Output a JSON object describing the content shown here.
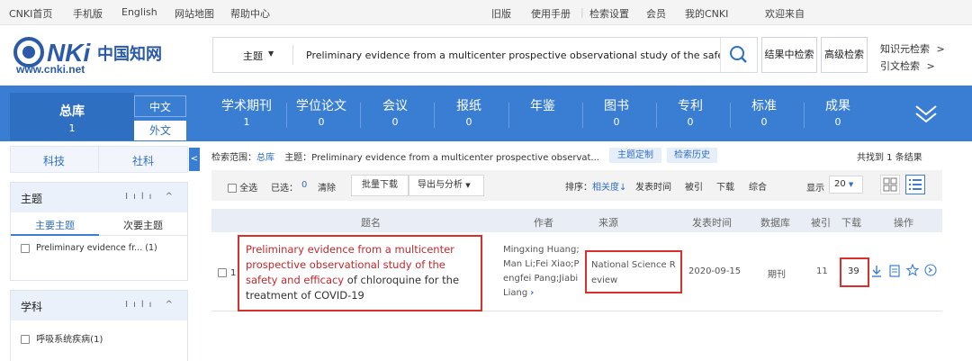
{
  "topbar": {
    "left_links": [
      "CNKI首页",
      "手机版",
      "English",
      "网站地图",
      "帮助中心"
    ],
    "right_links": [
      "旧版",
      "使用手册",
      "检索设置",
      "会员",
      "我的CNKI"
    ],
    "welcome": "欢迎来自"
  },
  "logo": {
    "brand": "CNKi中国知网",
    "url_text": "www.cnki.net"
  },
  "search": {
    "field": "主题",
    "query": "Preliminary evidence from a multicenter prospective observational study of the safe",
    "search_in_results": "结果中检索",
    "advanced": "高级检索",
    "knowledge_search": "知识元检索",
    "citation_search": "引文检索"
  },
  "nav": {
    "total_label": "总库",
    "total_count": "1",
    "chinese": "中文",
    "foreign": "外文",
    "items": [
      {
        "label": "学术期刊",
        "count": "1"
      },
      {
        "label": "学位论文",
        "count": "0"
      },
      {
        "label": "会议",
        "count": "0"
      },
      {
        "label": "报纸",
        "count": "0"
      },
      {
        "label": "年鉴",
        "count": ""
      },
      {
        "label": "图书",
        "count": "0"
      },
      {
        "label": "专利",
        "count": "0"
      },
      {
        "label": "标准",
        "count": "0"
      },
      {
        "label": "成果",
        "count": "0"
      }
    ]
  },
  "left": {
    "tabs": [
      "科技",
      "社科"
    ],
    "topic": {
      "title": "主题",
      "subtabs": [
        "主要主题",
        "次要主题"
      ],
      "item": "Preliminary evidence fr... (1)"
    },
    "subject": {
      "title": "学科",
      "item": "呼吸系统疾病(1)"
    }
  },
  "main": {
    "scope_label": "检索范围：",
    "scope_value": "总库",
    "scope_topic": "主题：Preliminary evidence from a multicenter prospective observat...",
    "topic_custom": "主题定制",
    "history": "检索历史",
    "found": "共找到 1 条结果",
    "toolbar": {
      "select_all": "全选",
      "selected_label": "已选：",
      "selected_count": "0",
      "clear": "清除",
      "batch_download": "批量下载",
      "export": "导出与分析",
      "sort_label": "排序：",
      "sort_options": [
        "相关度",
        "发表时间",
        "被引",
        "下载",
        "综合"
      ],
      "display_label": "显示",
      "display_value": "20"
    },
    "columns": [
      "题名",
      "作者",
      "来源",
      "发表时间",
      "数据库",
      "被引",
      "下载",
      "操作"
    ],
    "row": {
      "index": "1",
      "title_highlight": "Preliminary evidence from a multicenter prospective observational study of the safety and efficacy",
      "title_rest": " of chloroquine for the treatment of COVID-19",
      "authors": "Mingxing Huang;Man Li;Fei Xiao;Pengfei Pang;Jiabi Liang",
      "source": "National Science Review",
      "date": "2020-09-15",
      "database": "期刊",
      "cited": "11",
      "downloads": "39"
    }
  },
  "colors": {
    "brand_blue": "#3a7ed3",
    "highlight_red": "#d9302b"
  }
}
